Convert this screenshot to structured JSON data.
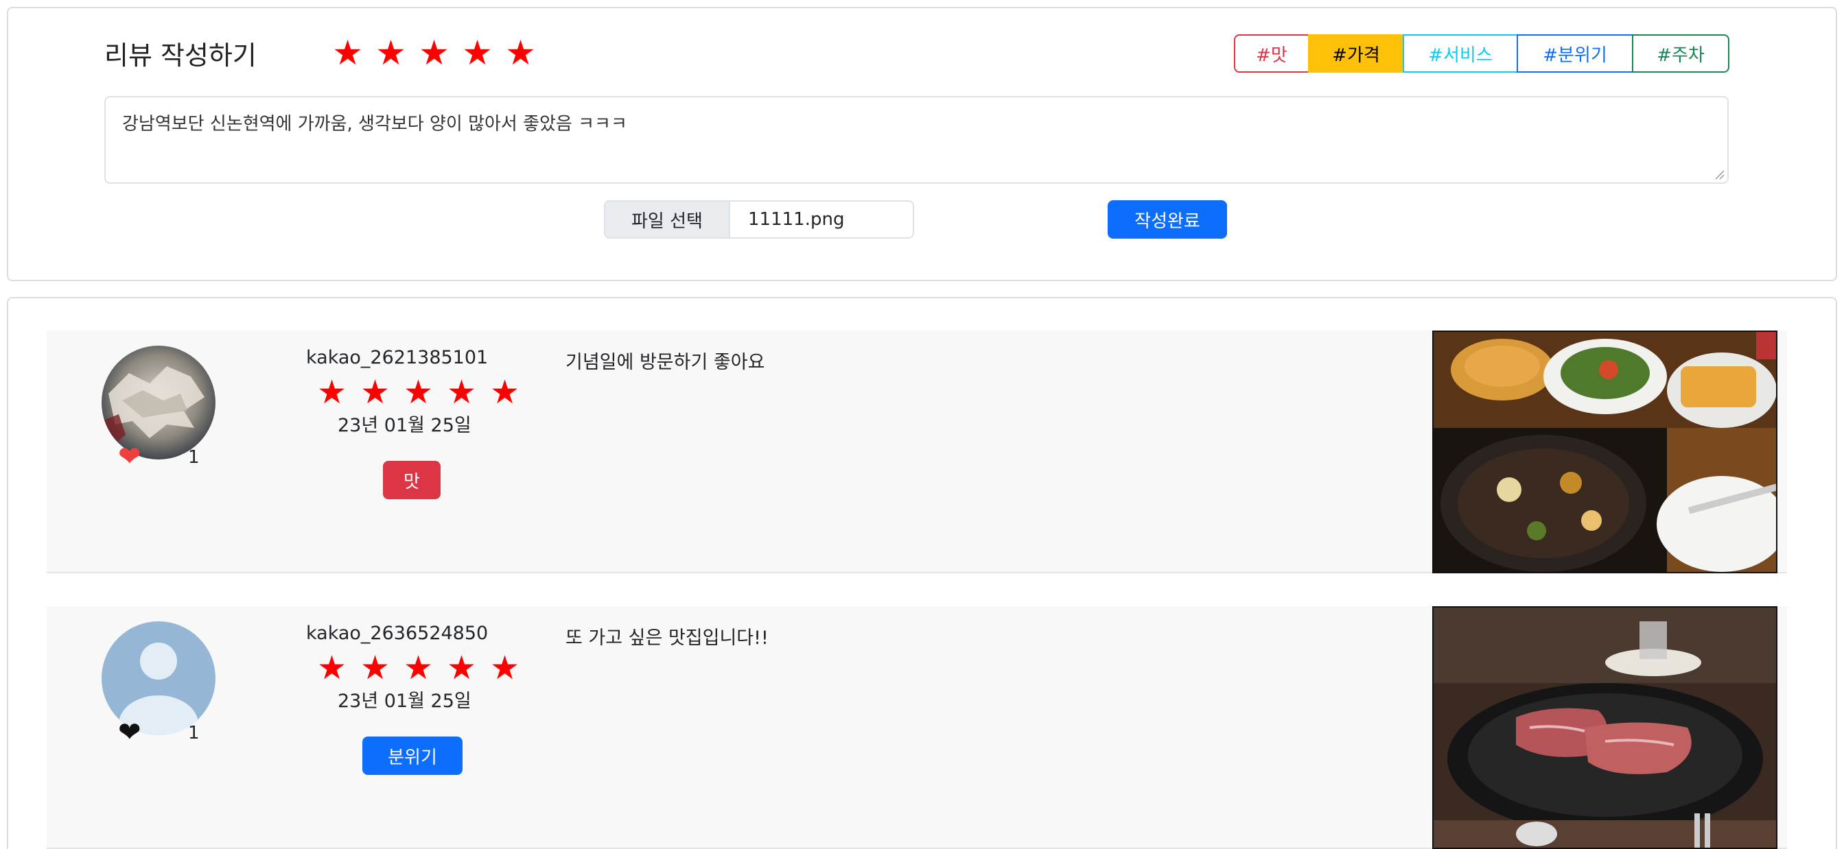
{
  "write": {
    "title": "리뷰 작성하기",
    "stars": [
      "★",
      "★",
      "★",
      "★",
      "★"
    ],
    "tags": [
      {
        "label": "#맛",
        "color": "#dc3545",
        "active": false
      },
      {
        "label": "#가격",
        "color": "#ffc107",
        "active": true
      },
      {
        "label": "#서비스",
        "color": "#0dcaf0",
        "active": false
      },
      {
        "label": "#분위기",
        "color": "#0d6efd",
        "active": false
      },
      {
        "label": "#주차",
        "color": "#198754",
        "active": false
      }
    ],
    "textarea_value": "강남역보단 신논현역에 가까움, 생각보다 양이 많아서 좋았음 ㅋㅋㅋ",
    "file_button_label": "파일 선택",
    "file_name": "11111.png",
    "submit_label": "작성완료"
  },
  "reviews": [
    {
      "username": "kakao_2621385101",
      "stars": [
        "★",
        "★",
        "★",
        "★",
        "★"
      ],
      "date": "23년 01월 25일",
      "category": "맛",
      "category_color": "#dc3545",
      "text": "기념일에 방문하기 좋아요",
      "likes": "1",
      "liked": true,
      "like_icon": "heart-icon"
    },
    {
      "username": "kakao_2636524850",
      "stars": [
        "★",
        "★",
        "★",
        "★",
        "★"
      ],
      "date": "23년 01월 25일",
      "category": "분위기",
      "category_color": "#0d6efd",
      "text": "또 가고 싶은 맛집입니다!!",
      "likes": "1",
      "liked": false,
      "like_icon": "heart-icon"
    }
  ],
  "colors": {
    "star": "#ff0000",
    "primary": "#0d6efd",
    "like_active": "#f03e3e",
    "like_inactive": "#111111"
  }
}
